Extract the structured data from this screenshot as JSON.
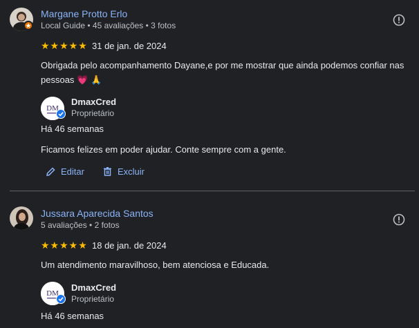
{
  "reviews": [
    {
      "author": "Margane Protto Erlo",
      "meta": "Local Guide • 45 avaliações • 3 fotos",
      "stars": "★★★★★",
      "rating": 5,
      "date": "31 de jan. de 2024",
      "text": "Obrigada pelo acompanhamento Dayane,e por me mostrar que ainda podemos confiar nas",
      "text_line2": "pessoas",
      "emojis": "💗 🙏",
      "reply": {
        "owner_name": "DmaxCred",
        "owner_role": "Proprietário",
        "logo_text": "DM",
        "ago": "Há 46 semanas",
        "text": "Ficamos felizes em poder ajudar. Conte sempre com a gente.",
        "edit_label": "Editar",
        "delete_label": "Excluir"
      }
    },
    {
      "author": "Jussara Aparecida Santos",
      "meta": "5 avaliações • 2 fotos",
      "stars": "★★★★★",
      "rating": 5,
      "date": "18 de jan. de 2024",
      "text": "Um atendimento maravilhoso, bem atenciosa e Educada.",
      "reply": {
        "owner_name": "DmaxCred",
        "owner_role": "Proprietário",
        "logo_text": "DM",
        "ago": "Há 46 semanas"
      }
    }
  ],
  "colors": {
    "background": "#202124",
    "link": "#8ab4f8",
    "star": "#fbbc04",
    "local_guide_badge": "#e37400",
    "verified": "#1a73e8"
  }
}
